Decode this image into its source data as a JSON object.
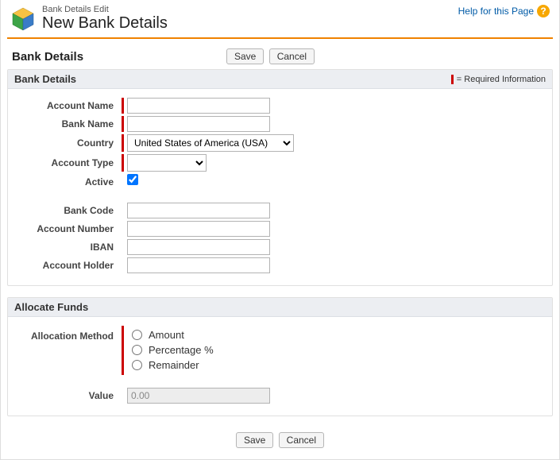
{
  "header": {
    "breadcrumb": "Bank Details Edit",
    "title": "New Bank Details",
    "help_label": "Help for this Page"
  },
  "actions": {
    "save": "Save",
    "cancel": "Cancel"
  },
  "main": {
    "title": "Bank Details"
  },
  "panel1": {
    "title": "Bank Details",
    "required_legend": "= Required Information",
    "labels": {
      "account_name": "Account Name",
      "bank_name": "Bank Name",
      "country": "Country",
      "account_type": "Account Type",
      "active": "Active",
      "bank_code": "Bank Code",
      "account_number": "Account Number",
      "iban": "IBAN",
      "account_holder": "Account Holder"
    },
    "values": {
      "account_name": "",
      "bank_name": "",
      "country_selected": "United States of America (USA)",
      "account_type_selected": "",
      "active_checked": true,
      "bank_code": "",
      "account_number": "",
      "iban": "",
      "account_holder": ""
    }
  },
  "panel2": {
    "title": "Allocate Funds",
    "labels": {
      "allocation_method": "Allocation Method",
      "value": "Value"
    },
    "options": {
      "amount": "Amount",
      "percentage": "Percentage %",
      "remainder": "Remainder"
    },
    "values": {
      "allocation_selected": "",
      "value_field": "0.00"
    }
  }
}
